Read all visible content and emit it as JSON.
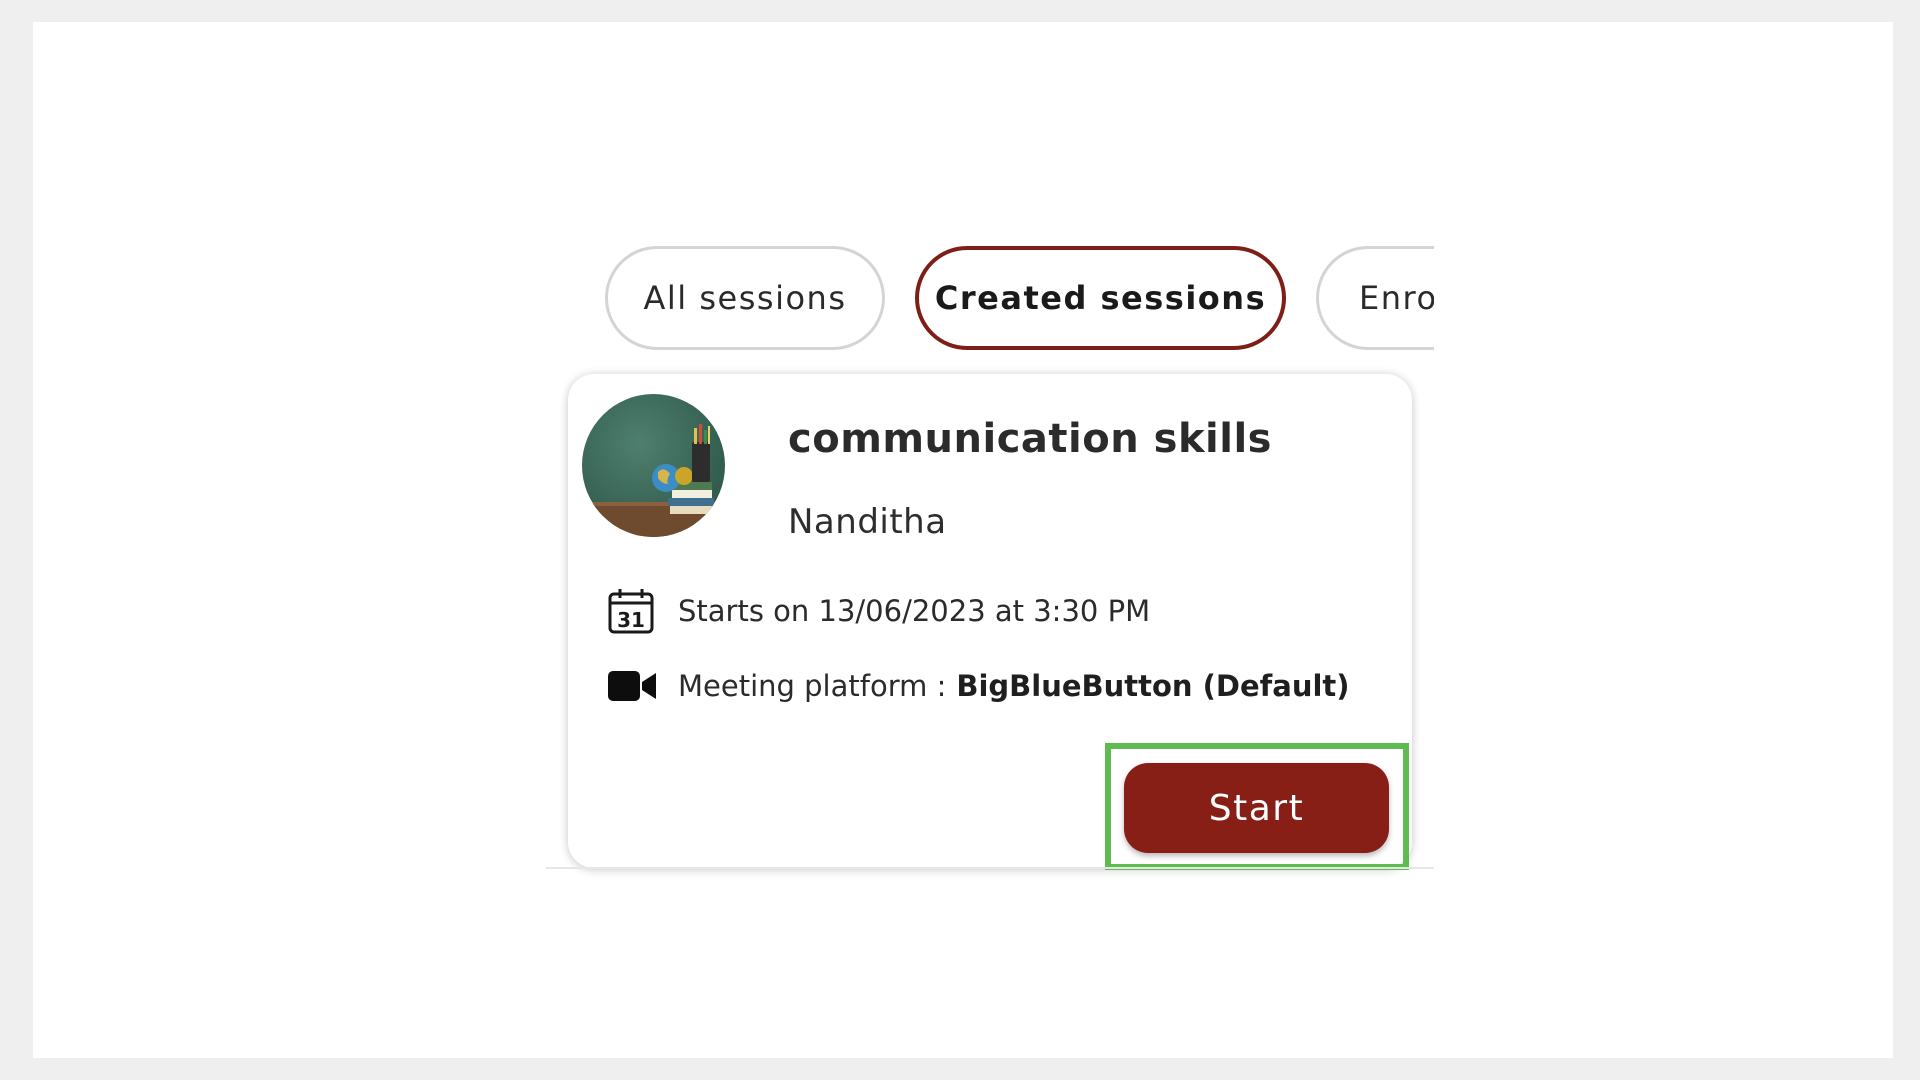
{
  "tabs": [
    {
      "label": "All sessions",
      "active": false
    },
    {
      "label": "Created sessions",
      "active": true
    },
    {
      "label": "Enrolled sessions",
      "visible_text": "Enro",
      "active": false
    }
  ],
  "session": {
    "title": "communication skills",
    "author": "Nanditha",
    "start_text": "Starts on 13/06/2023 at 3:30 PM",
    "calendar_day": "31",
    "platform_label": "Meeting platform :",
    "platform_value": "BigBlueButton (Default)",
    "start_button": "Start"
  },
  "icons": {
    "date": "calendar-icon",
    "platform": "video-camera-icon"
  },
  "colors": {
    "accent": "#871f16",
    "active_tab_border": "#7e1f17",
    "highlight": "#5dbb4f"
  }
}
